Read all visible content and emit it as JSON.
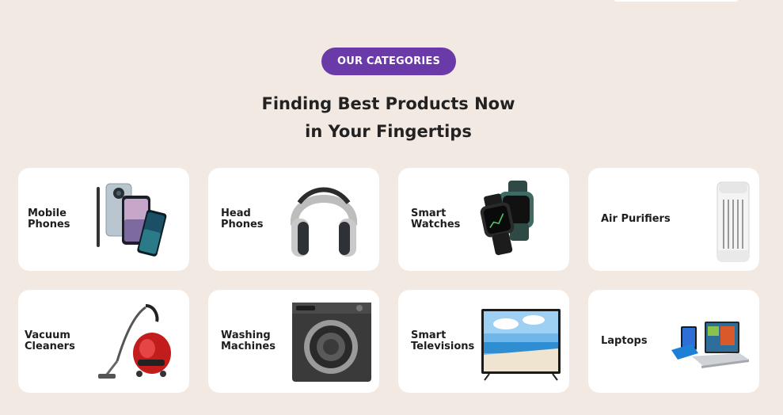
{
  "section": {
    "badge": "OUR CATEGORIES",
    "heading_line1": "Finding Best Products Now",
    "heading_line2": "in Your Fingertips"
  },
  "categories": [
    {
      "label": "Mobile\nPhones",
      "icon": "smartphones-icon"
    },
    {
      "label": "Head\nPhones",
      "icon": "headphones-icon"
    },
    {
      "label": "Smart\nWatches",
      "icon": "smartwatch-icon"
    },
    {
      "label": "Air Purifiers",
      "icon": "air-purifier-icon"
    },
    {
      "label": "Vacuum\nCleaners",
      "icon": "vacuum-cleaner-icon"
    },
    {
      "label": "Washing\nMachines",
      "icon": "washing-machine-icon"
    },
    {
      "label": "Smart\nTelevisions",
      "icon": "television-icon"
    },
    {
      "label": "Laptops",
      "icon": "laptop-icon"
    }
  ],
  "colors": {
    "background": "#f3e9e3",
    "badge": "#6a3aa8",
    "card": "#ffffff",
    "text": "#222222"
  }
}
